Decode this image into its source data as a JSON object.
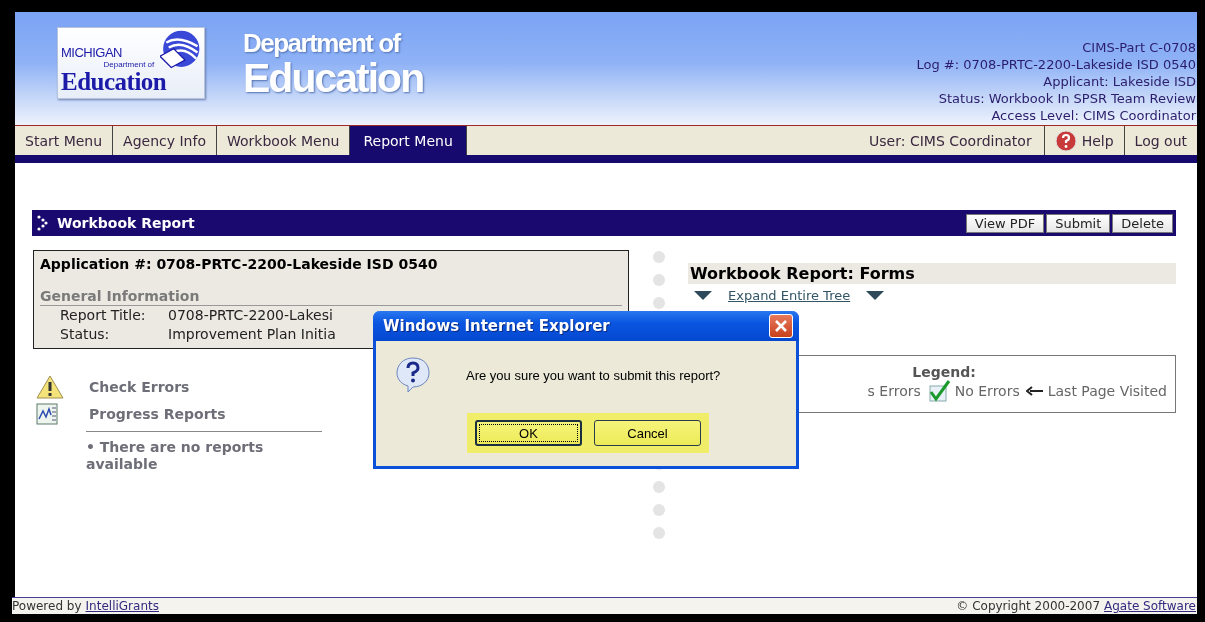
{
  "header": {
    "logo": {
      "line1": "MICHIGAN",
      "line2": "Department of",
      "line3": "Education"
    },
    "title_line1": "Department of",
    "title_line2": "Education",
    "info_lines": [
      "CIMS-Part C-0708",
      "Log #: 0708-PRTC-2200-Lakeside ISD 0540",
      "Applicant: Lakeside ISD",
      "Status: Workbook In SPSR Team Review",
      "Access Level: CIMS Coordinator"
    ]
  },
  "nav": {
    "tabs": [
      {
        "label": "Start Menu",
        "selected": false
      },
      {
        "label": "Agency Info",
        "selected": false
      },
      {
        "label": "Workbook Menu",
        "selected": false
      },
      {
        "label": "Report Menu",
        "selected": true
      }
    ],
    "user": "User: CIMS Coordinator",
    "help": "Help",
    "logout": "Log out"
  },
  "section": {
    "title": "Workbook Report",
    "buttons": [
      "View PDF",
      "Submit",
      "Delete"
    ]
  },
  "application": {
    "heading": "Application #: 0708-PRTC-2200-Lakeside ISD 0540",
    "subheading": "General Information",
    "fields": [
      {
        "label": "Report Title:",
        "value": "0708-PRTC-2200-Lakesi"
      },
      {
        "label": "Status:",
        "value": "Improvement Plan Initia"
      }
    ]
  },
  "actions": [
    {
      "kind": "warning",
      "label": "Check Errors"
    },
    {
      "kind": "chart",
      "label": "Progress Reports"
    }
  ],
  "reports_note": "• There are no reports available",
  "forms": {
    "title": "Workbook Report: Forms",
    "expand_link": "Expand Entire Tree",
    "legend": {
      "title": "Legend:",
      "items": [
        {
          "kind": "none",
          "label": "s Errors"
        },
        {
          "kind": "check",
          "label": "No Errors"
        },
        {
          "kind": "arrow",
          "label": "Last Page Visited"
        }
      ]
    }
  },
  "dialog": {
    "title": "Windows Internet Explorer",
    "message": "Are you sure you want to submit this report?",
    "buttons": [
      {
        "label": "OK",
        "selected": true
      },
      {
        "label": "Cancel",
        "selected": false
      }
    ]
  },
  "footer": {
    "powered_by": "Powered by",
    "link": "IntelliGrants",
    "copyright": "© Copyright 2000-2007",
    "company": "Agate Software"
  }
}
